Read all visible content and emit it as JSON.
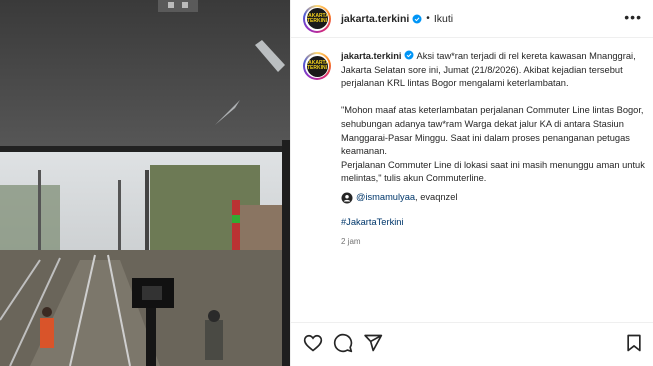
{
  "post": {
    "username": "jakarta.terkini",
    "separator": "•",
    "follow_label": "Ikuti",
    "more_label": "•••",
    "avatar_text": "JAKARTA TERKINI",
    "caption": {
      "username": "jakarta.terkini",
      "p1": "Aksi taw*ran terjadi di rel kereta kawasan Mnanggrai, Jakarta Selatan sore ini, Jumat (21/8/2026). Akibat kejadian tersebut perjalanan KRL lintas Bogor mengalami keterlambatan.",
      "p2": "\"Mohon maaf atas keterlambatan perjalanan Commuter Line lintas Bogor, sehubungan adanya taw*ram Warga dekat jalur KA di antara Stasiun Manggarai-Pasar Minggu. Saat ini dalam proses penanganan petugas keamanan.",
      "p3": "Perjalanan Commuter Line di lokasi saat ini masih menunggu aman untuk melintas,\" tulis akun Commuterline.",
      "tag_user": "@ismamulyaa",
      "tag_rest": ", evaqnzel",
      "hashtag": "#JakartaTerkini",
      "time": "2 jam"
    }
  },
  "colors": {
    "verified": "#0095f6",
    "link": "#00376b"
  }
}
